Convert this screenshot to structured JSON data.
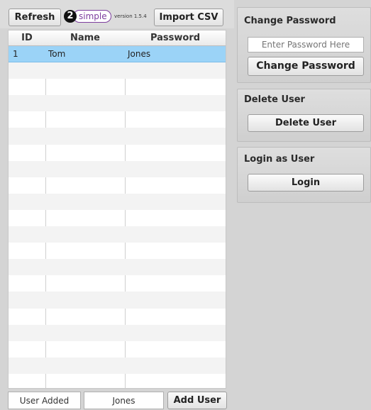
{
  "toolbar": {
    "refresh_label": "Refresh",
    "logo_number": "2",
    "logo_text": "simple",
    "version": "version 1.5.4",
    "import_label": "Import CSV"
  },
  "table": {
    "headers": {
      "id": "ID",
      "name": "Name",
      "password": "Password"
    },
    "rows": [
      {
        "id": "1",
        "name": "Tom",
        "password": "Jones",
        "selected": true
      }
    ],
    "total_rows": 22
  },
  "add_user": {
    "name_value": "User Added",
    "password_value": "Jones",
    "add_label": "Add User"
  },
  "change_password": {
    "title": "Change Password",
    "placeholder": "Enter Password Here",
    "button_label": "Change Password"
  },
  "delete_user": {
    "title": "Delete User",
    "button_label": "Delete User"
  },
  "login_as_user": {
    "title": "Login as User",
    "button_label": "Login"
  },
  "colors": {
    "selected_row": "#9bd3f7",
    "logo_accent": "#7d3e9e"
  }
}
